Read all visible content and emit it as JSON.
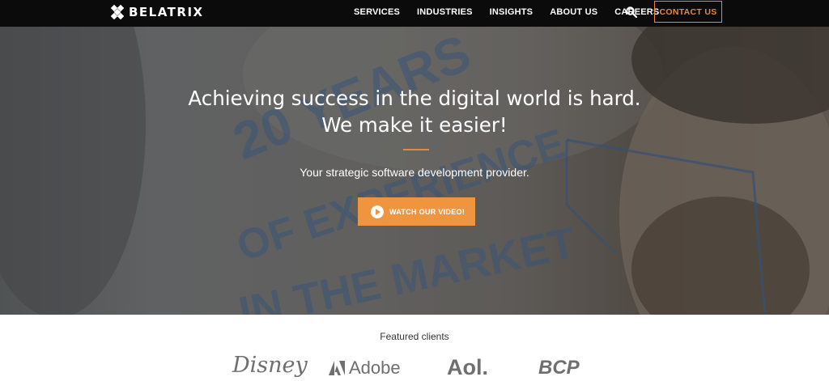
{
  "brand": {
    "name": "BELATRIX"
  },
  "nav": {
    "items": [
      "SERVICES",
      "INDUSTRIES",
      "INSIGHTS",
      "ABOUT US",
      "CAREERS"
    ],
    "search_icon": "search-icon",
    "contact_label": "CONTACT US"
  },
  "hero": {
    "headline_line1": "Achieving success in the digital world is hard.",
    "headline_line2": "We make it easier!",
    "subheadline": "Your strategic software development provider.",
    "video_label": "WATCH OUR VIDEO!",
    "background_text": [
      "20 YEARS",
      "OF EXPERIENCE",
      "IN THE MARKET"
    ]
  },
  "clients": {
    "title": "Featured clients",
    "logos": [
      "Disney",
      "Adobe",
      "Aol.",
      "BCP"
    ]
  },
  "colors": {
    "accent": "#f0953f",
    "nav_bg": "#0b0b0b"
  }
}
